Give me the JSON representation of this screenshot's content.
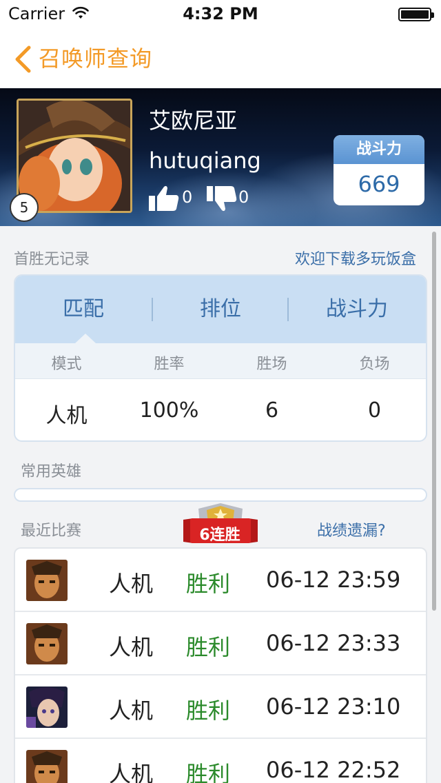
{
  "status_bar": {
    "carrier": "Carrier",
    "time": "4:32 PM"
  },
  "nav": {
    "back_icon": "chevron-left-icon",
    "title": "召唤师查询"
  },
  "profile": {
    "name": "艾欧尼亚",
    "account": "hutuqiang",
    "level": "5",
    "likes": "0",
    "dislikes": "0",
    "power_label": "战斗力",
    "power_value": "669"
  },
  "first_win": {
    "label": "首胜无记录",
    "link": "欢迎下载多玩饭盒"
  },
  "stats": {
    "tabs": [
      {
        "label": "匹配",
        "active": true
      },
      {
        "label": "排位",
        "active": false
      },
      {
        "label": "战斗力",
        "active": false
      }
    ],
    "columns": [
      "模式",
      "胜率",
      "胜场",
      "负场"
    ],
    "row": [
      "人机",
      "100%",
      "6",
      "0"
    ]
  },
  "common_heroes": {
    "label": "常用英雄"
  },
  "recent_matches": {
    "label": "最近比赛",
    "streak": "6连胜",
    "missing_link": "战绩遗漏?",
    "items": [
      {
        "mode": "人机",
        "result": "胜利",
        "time": "06-12 23:59",
        "hero_icon": "hero-portrait-icon"
      },
      {
        "mode": "人机",
        "result": "胜利",
        "time": "06-12 23:33",
        "hero_icon": "hero-portrait-icon"
      },
      {
        "mode": "人机",
        "result": "胜利",
        "time": "06-12 23:10",
        "hero_icon": "hero-portrait-icon"
      },
      {
        "mode": "人机",
        "result": "胜利",
        "time": "06-12 22:52",
        "hero_icon": "hero-portrait-icon"
      }
    ]
  },
  "colors": {
    "accent": "#f39a27",
    "link": "#3a6ea8",
    "win": "#2b8a2b",
    "tab_bg": "#c9def3"
  }
}
